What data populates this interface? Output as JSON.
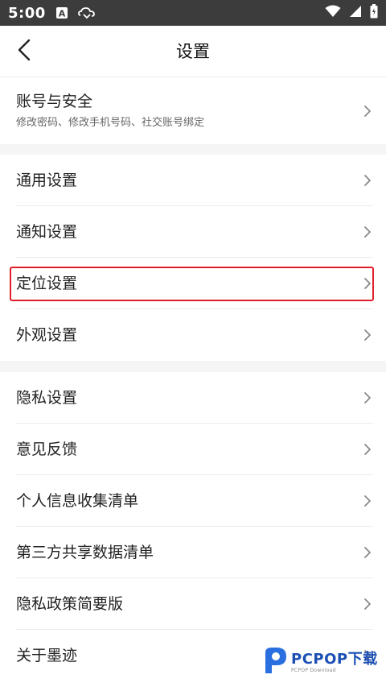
{
  "status_bar": {
    "time": "5:00",
    "left_icons": [
      "a-box-icon",
      "cloud-sync-icon"
    ],
    "right_icons": [
      "wifi-icon",
      "signal-icon",
      "battery-icon"
    ]
  },
  "header": {
    "title": "设置",
    "back_icon": "chevron-left-icon"
  },
  "sections": [
    {
      "items": [
        {
          "label": "账号与安全",
          "subtitle": "修改密码、修改手机号码、社交账号绑定"
        }
      ]
    },
    {
      "items": [
        {
          "label": "通用设置"
        },
        {
          "label": "通知设置"
        },
        {
          "label": "定位设置",
          "highlighted": true
        },
        {
          "label": "外观设置"
        }
      ]
    },
    {
      "items": [
        {
          "label": "隐私设置"
        },
        {
          "label": "意见反馈"
        },
        {
          "label": "个人信息收集清单"
        },
        {
          "label": "第三方共享数据清单"
        },
        {
          "label": "隐私政策简要版"
        },
        {
          "label": "关于墨迹"
        }
      ]
    }
  ],
  "watermark": {
    "brand": "PCPOP下载",
    "sub": "PCPOP Download"
  },
  "colors": {
    "status_bar": "#3c3c3c",
    "section_gap": "#f5f5f5",
    "highlight_border": "#e01e2b",
    "watermark_blue": "#1c4fb4"
  }
}
